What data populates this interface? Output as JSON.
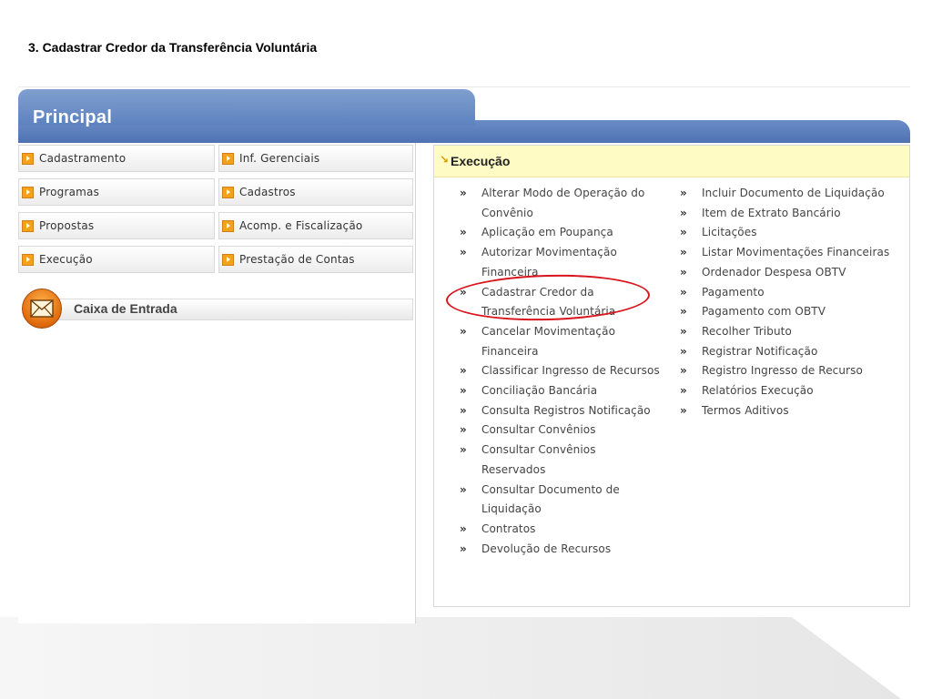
{
  "slide": {
    "title": "3. Cadastrar Credor da Transferência Voluntária"
  },
  "app": {
    "tab_label": "Principal",
    "nav": [
      {
        "label": "Cadastramento"
      },
      {
        "label": "Inf. Gerenciais"
      },
      {
        "label": "Programas"
      },
      {
        "label": "Cadastros"
      },
      {
        "label": "Propostas"
      },
      {
        "label": "Acomp. e Fiscalização"
      },
      {
        "label": "Execução"
      },
      {
        "label": "Prestação de Contas"
      }
    ],
    "inbox_label": "Caixa de Entrada",
    "panel": {
      "title": "Execução",
      "col1": [
        "Alterar Modo de Operação do Convênio",
        "Aplicação em Poupança",
        "Autorizar Movimentação Financeira",
        "Cadastrar Credor da Transferência Voluntária",
        "Cancelar Movimentação Financeira",
        "Classificar Ingresso de Recursos",
        "Conciliação Bancária",
        "Consulta Registros Notificação",
        "Consultar Convênios",
        "Consultar Convênios Reservados",
        "Consultar Documento de Liquidação",
        "Contratos",
        "Devolução de Recursos"
      ],
      "col2": [
        "Incluir Documento de Liquidação",
        "Item de Extrato Bancário",
        "Licitações",
        "Listar Movimentações Financeiras",
        "Ordenador Despesa OBTV",
        "Pagamento",
        "Pagamento com OBTV",
        "Recolher Tributo",
        "Registrar Notificação",
        "Registro Ingresso de Recurso",
        "Relatórios Execução",
        "Termos Aditivos"
      ]
    },
    "highlight_color": "#d8141c",
    "accent_color": "#5d82bf",
    "nav_icon_color": "#f3a21a"
  }
}
